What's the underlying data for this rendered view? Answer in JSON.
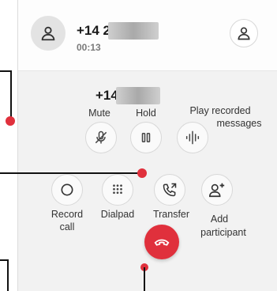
{
  "header": {
    "caller_number": "+14            258",
    "timer": "00:13"
  },
  "body": {
    "active_number": "+14            258"
  },
  "controls": {
    "mute": "Mute",
    "hold": "Hold",
    "play_recorded_line1": "Play recorded",
    "play_recorded_line2": "messages",
    "record_line1": "Record",
    "record_line2": "call",
    "dialpad": "Dialpad",
    "transfer": "Transfer",
    "add_line1": "Add",
    "add_line2": "participant"
  },
  "colors": {
    "end_call": "#e0303c",
    "annotation_dot": "#e0303c"
  }
}
